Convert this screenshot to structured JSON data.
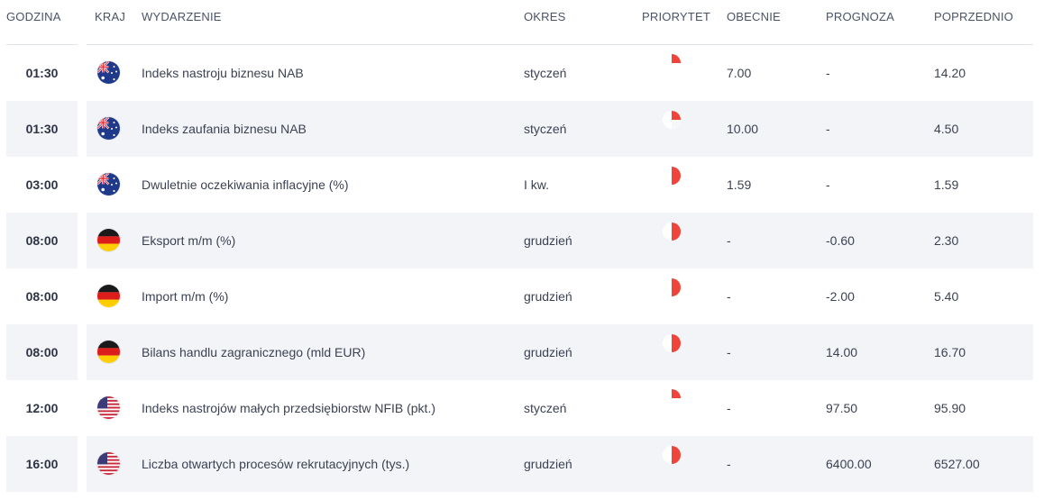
{
  "header": {
    "time": "GODZINA",
    "country": "KRAJ",
    "event": "WYDARZENIE",
    "period": "OKRES",
    "priority": "PRIORYTET",
    "actual": "OBECNIE",
    "forecast": "PROGNOZA",
    "previous": "POPRZEDNIO"
  },
  "colors": {
    "priority_red": "#f0433a",
    "alt_row": "#f2f4f8"
  },
  "rows": [
    {
      "time": "01:30",
      "country_flag": "australia-flag-icon",
      "event": "Indeks nastroju biznesu NAB",
      "period": "styczeń",
      "priority": "high",
      "actual": "7.00",
      "forecast": "-",
      "previous": "14.20"
    },
    {
      "time": "01:30",
      "country_flag": "australia-flag-icon",
      "event": "Indeks zaufania biznesu NAB",
      "period": "styczeń",
      "priority": "medium",
      "actual": "10.00",
      "forecast": "-",
      "previous": "4.50"
    },
    {
      "time": "03:00",
      "country_flag": "australia-flag-icon",
      "event": "Dwuletnie oczekiwania inflacyjne (%)",
      "period": "I kw.",
      "priority": "low",
      "actual": "1.59",
      "forecast": "-",
      "previous": "1.59"
    },
    {
      "time": "08:00",
      "country_flag": "germany-flag-icon",
      "event": "Eksport m/m (%)",
      "period": "grudzień",
      "priority": "low",
      "actual": "-",
      "forecast": "-0.60",
      "previous": "2.30"
    },
    {
      "time": "08:00",
      "country_flag": "germany-flag-icon",
      "event": "Import m/m (%)",
      "period": "grudzień",
      "priority": "low",
      "actual": "-",
      "forecast": "-2.00",
      "previous": "5.40"
    },
    {
      "time": "08:00",
      "country_flag": "germany-flag-icon",
      "event": "Bilans handlu zagranicznego (mld EUR)",
      "period": "grudzień",
      "priority": "low",
      "actual": "-",
      "forecast": "14.00",
      "previous": "16.70"
    },
    {
      "time": "12:00",
      "country_flag": "usa-flag-icon",
      "event": "Indeks nastrojów małych przedsiębiorstw NFIB (pkt.)",
      "period": "styczeń",
      "priority": "high",
      "actual": "-",
      "forecast": "97.50",
      "previous": "95.90"
    },
    {
      "time": "16:00",
      "country_flag": "usa-flag-icon",
      "event": "Liczba otwartych procesów rekrutacyjnych (tys.)",
      "period": "grudzień",
      "priority": "low",
      "actual": "-",
      "forecast": "6400.00",
      "previous": "6527.00"
    }
  ]
}
